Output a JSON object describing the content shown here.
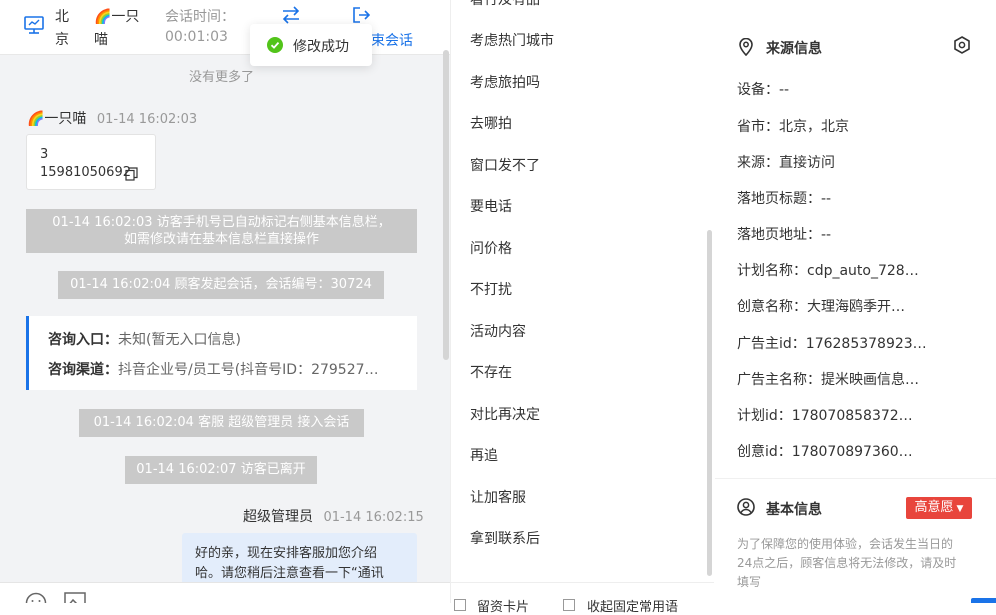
{
  "header": {
    "visitor_location": "北京",
    "visitor_name": "🌈一只喵",
    "session_time_label": "会话时间：",
    "session_time_value": "00:01:03",
    "end_session_label": "束会话"
  },
  "toast": {
    "text": "修改成功"
  },
  "chat": {
    "no_more": "没有更多了",
    "messages": [
      {
        "sender": "🌈一只喵",
        "time": "01-14 16:02:03",
        "line1": "3",
        "line2": "15981050692"
      },
      {
        "system_line1": "01-14 16:02:03 访客手机号已自动标记右侧基本信息栏，",
        "system_line2": "如需修改请在基本信息栏直接操作"
      },
      {
        "system": "01-14 16:02:04 顾客发起会话，会话编号：30724"
      },
      {
        "entry_label": "咨询入口：",
        "entry_value": "未知(暂无入口信息)",
        "channel_label": "咨询渠道：",
        "channel_value": "抖音企业号/员工号(抖音号ID：279527…"
      },
      {
        "system": "01-14 16:02:04 客服 超级管理员 接入会话"
      },
      {
        "system": "01-14 16:02:07 访客已离开"
      },
      {
        "sender": "超级管理员",
        "time": "01-14 16:02:15",
        "line1": "好的亲，现在安排客服加您介绍",
        "line2": "哈。请您稍后注意查看一下“通讯"
      }
    ]
  },
  "quick_replies": {
    "items": [
      "看行及有品",
      "考虑热门城市",
      "考虑旅拍吗",
      "去哪拍",
      "窗口发不了",
      "要电话",
      "问价格",
      "不打扰",
      "活动内容",
      "不存在",
      "对比再决定",
      "再追",
      "让加客服",
      "拿到联系后"
    ],
    "footer_option1": "留资卡片",
    "footer_option2": "收起固定常用语"
  },
  "source_info": {
    "title": "来源信息",
    "rows": [
      {
        "label": "设备：",
        "value": "--"
      },
      {
        "label": "省市：",
        "value": "北京，北京"
      },
      {
        "label": "来源：",
        "value": "直接访问"
      },
      {
        "label": "落地页标题：",
        "value": "--"
      },
      {
        "label": "落地页地址：",
        "value": "--"
      },
      {
        "label": "计划名称：",
        "value": "cdp_auto_728…"
      },
      {
        "label": "创意名称：",
        "value": "大理海鸥季开…"
      },
      {
        "label": "广告主id：",
        "value": "176285378923…"
      },
      {
        "label": "广告主名称：",
        "value": "提米映画信息…"
      },
      {
        "label": "计划id：",
        "value": "178070858372…"
      },
      {
        "label": "创意id：",
        "value": "178070897360…"
      }
    ]
  },
  "basic_info": {
    "title": "基本信息",
    "intent_badge": "高意愿",
    "notice": "为了保障您的使用体验，会话发生当日的24点之后，顾客信息将无法修改，请及时填写"
  },
  "colors": {
    "accent": "#1a73e8",
    "success": "#52c41a",
    "danger": "#e8453c",
    "system_bubble": "#c9c9c9"
  }
}
